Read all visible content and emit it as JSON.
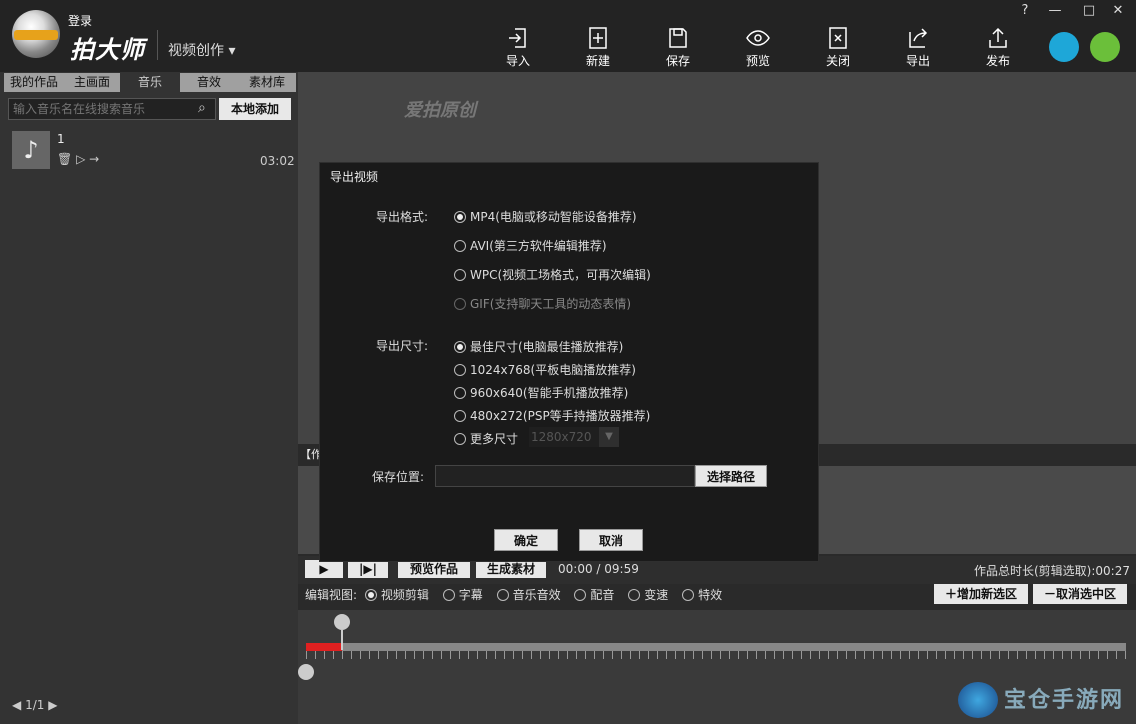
{
  "app": {
    "title": "拍大师",
    "login": "登录",
    "mode": "视频创作"
  },
  "toolbar": [
    {
      "label": "导入",
      "icon": "import-icon"
    },
    {
      "label": "新建",
      "icon": "new-icon"
    },
    {
      "label": "保存",
      "icon": "save-icon"
    },
    {
      "label": "预览",
      "icon": "preview-eye-icon"
    },
    {
      "label": "关闭",
      "icon": "close-doc-icon"
    },
    {
      "label": "导出",
      "icon": "export-icon"
    },
    {
      "label": "发布",
      "icon": "publish-icon"
    }
  ],
  "window_buttons": {
    "help": "?",
    "minimize": "—",
    "maximize": "□",
    "close": "✕"
  },
  "left_tabs": [
    "我的作品",
    "主画面",
    "音乐",
    "音效",
    "素材库"
  ],
  "music": {
    "search_placeholder": "输入音乐名在线搜索音乐",
    "add_local": "本地添加",
    "items": [
      {
        "title": "1",
        "duration": "03:02"
      }
    ],
    "page": "1/1"
  },
  "preview": {
    "watermark": "爱拍原创"
  },
  "materials_label": "【作品素材】",
  "controls": {
    "play": "▶",
    "step": "|▶|",
    "preview_work": "预览作品",
    "generate": "生成素材",
    "time": "00:00 / 09:59",
    "total": "作品总时长(剪辑选取):00:27"
  },
  "edit_view": {
    "label": "编辑视图:",
    "options": [
      "视频剪辑",
      "字幕",
      "音乐音效",
      "配音",
      "变速",
      "特效"
    ],
    "selected": 0,
    "add_selection": "增加新选区",
    "cancel_selection": "取消选中区"
  },
  "dialog": {
    "title": "导出视频",
    "format_label": "导出格式:",
    "formats": [
      {
        "text": "MP4(电脑或移动智能设备推荐)",
        "selected": true,
        "disabled": false
      },
      {
        "text": "AVI(第三方软件编辑推荐)",
        "selected": false,
        "disabled": false
      },
      {
        "text": "WPC(视频工场格式，可再次编辑)",
        "selected": false,
        "disabled": false
      },
      {
        "text": "GIF(支持聊天工具的动态表情)",
        "selected": false,
        "disabled": true
      }
    ],
    "size_label": "导出尺寸:",
    "sizes": [
      {
        "text": "最佳尺寸(电脑最佳播放推荐)",
        "selected": true
      },
      {
        "text": "1024x768(平板电脑播放推荐)",
        "selected": false
      },
      {
        "text": "960x640(智能手机播放推荐)",
        "selected": false
      },
      {
        "text": "480x272(PSP等手持播放器推荐)",
        "selected": false
      },
      {
        "text": "更多尺寸",
        "selected": false
      }
    ],
    "more_size_value": "1280x720",
    "save_label": "保存位置:",
    "save_path": "",
    "choose_path": "选择路径",
    "ok": "确定",
    "cancel": "取消"
  },
  "site_watermark": "宝仓手游网"
}
